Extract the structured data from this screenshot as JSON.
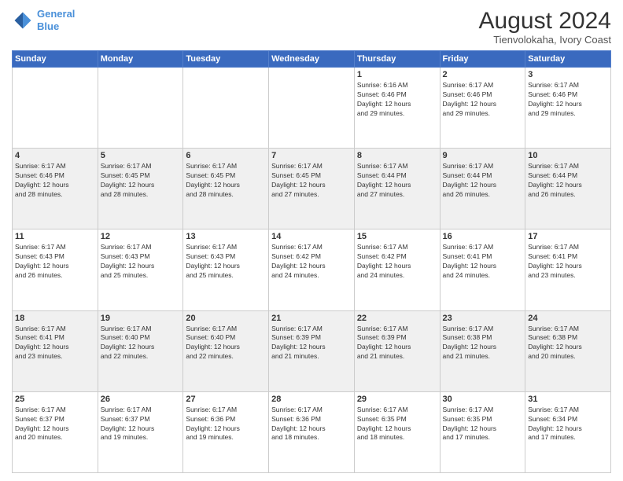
{
  "header": {
    "logo_line1": "General",
    "logo_line2": "Blue",
    "title": "August 2024",
    "subtitle": "Tienvolokaha, Ivory Coast"
  },
  "days_of_week": [
    "Sunday",
    "Monday",
    "Tuesday",
    "Wednesday",
    "Thursday",
    "Friday",
    "Saturday"
  ],
  "weeks": [
    [
      {
        "day": "",
        "info": ""
      },
      {
        "day": "",
        "info": ""
      },
      {
        "day": "",
        "info": ""
      },
      {
        "day": "",
        "info": ""
      },
      {
        "day": "1",
        "info": "Sunrise: 6:16 AM\nSunset: 6:46 PM\nDaylight: 12 hours\nand 29 minutes."
      },
      {
        "day": "2",
        "info": "Sunrise: 6:17 AM\nSunset: 6:46 PM\nDaylight: 12 hours\nand 29 minutes."
      },
      {
        "day": "3",
        "info": "Sunrise: 6:17 AM\nSunset: 6:46 PM\nDaylight: 12 hours\nand 29 minutes."
      }
    ],
    [
      {
        "day": "4",
        "info": "Sunrise: 6:17 AM\nSunset: 6:46 PM\nDaylight: 12 hours\nand 28 minutes."
      },
      {
        "day": "5",
        "info": "Sunrise: 6:17 AM\nSunset: 6:45 PM\nDaylight: 12 hours\nand 28 minutes."
      },
      {
        "day": "6",
        "info": "Sunrise: 6:17 AM\nSunset: 6:45 PM\nDaylight: 12 hours\nand 28 minutes."
      },
      {
        "day": "7",
        "info": "Sunrise: 6:17 AM\nSunset: 6:45 PM\nDaylight: 12 hours\nand 27 minutes."
      },
      {
        "day": "8",
        "info": "Sunrise: 6:17 AM\nSunset: 6:44 PM\nDaylight: 12 hours\nand 27 minutes."
      },
      {
        "day": "9",
        "info": "Sunrise: 6:17 AM\nSunset: 6:44 PM\nDaylight: 12 hours\nand 26 minutes."
      },
      {
        "day": "10",
        "info": "Sunrise: 6:17 AM\nSunset: 6:44 PM\nDaylight: 12 hours\nand 26 minutes."
      }
    ],
    [
      {
        "day": "11",
        "info": "Sunrise: 6:17 AM\nSunset: 6:43 PM\nDaylight: 12 hours\nand 26 minutes."
      },
      {
        "day": "12",
        "info": "Sunrise: 6:17 AM\nSunset: 6:43 PM\nDaylight: 12 hours\nand 25 minutes."
      },
      {
        "day": "13",
        "info": "Sunrise: 6:17 AM\nSunset: 6:43 PM\nDaylight: 12 hours\nand 25 minutes."
      },
      {
        "day": "14",
        "info": "Sunrise: 6:17 AM\nSunset: 6:42 PM\nDaylight: 12 hours\nand 24 minutes."
      },
      {
        "day": "15",
        "info": "Sunrise: 6:17 AM\nSunset: 6:42 PM\nDaylight: 12 hours\nand 24 minutes."
      },
      {
        "day": "16",
        "info": "Sunrise: 6:17 AM\nSunset: 6:41 PM\nDaylight: 12 hours\nand 24 minutes."
      },
      {
        "day": "17",
        "info": "Sunrise: 6:17 AM\nSunset: 6:41 PM\nDaylight: 12 hours\nand 23 minutes."
      }
    ],
    [
      {
        "day": "18",
        "info": "Sunrise: 6:17 AM\nSunset: 6:41 PM\nDaylight: 12 hours\nand 23 minutes."
      },
      {
        "day": "19",
        "info": "Sunrise: 6:17 AM\nSunset: 6:40 PM\nDaylight: 12 hours\nand 22 minutes."
      },
      {
        "day": "20",
        "info": "Sunrise: 6:17 AM\nSunset: 6:40 PM\nDaylight: 12 hours\nand 22 minutes."
      },
      {
        "day": "21",
        "info": "Sunrise: 6:17 AM\nSunset: 6:39 PM\nDaylight: 12 hours\nand 21 minutes."
      },
      {
        "day": "22",
        "info": "Sunrise: 6:17 AM\nSunset: 6:39 PM\nDaylight: 12 hours\nand 21 minutes."
      },
      {
        "day": "23",
        "info": "Sunrise: 6:17 AM\nSunset: 6:38 PM\nDaylight: 12 hours\nand 21 minutes."
      },
      {
        "day": "24",
        "info": "Sunrise: 6:17 AM\nSunset: 6:38 PM\nDaylight: 12 hours\nand 20 minutes."
      }
    ],
    [
      {
        "day": "25",
        "info": "Sunrise: 6:17 AM\nSunset: 6:37 PM\nDaylight: 12 hours\nand 20 minutes."
      },
      {
        "day": "26",
        "info": "Sunrise: 6:17 AM\nSunset: 6:37 PM\nDaylight: 12 hours\nand 19 minutes."
      },
      {
        "day": "27",
        "info": "Sunrise: 6:17 AM\nSunset: 6:36 PM\nDaylight: 12 hours\nand 19 minutes."
      },
      {
        "day": "28",
        "info": "Sunrise: 6:17 AM\nSunset: 6:36 PM\nDaylight: 12 hours\nand 18 minutes."
      },
      {
        "day": "29",
        "info": "Sunrise: 6:17 AM\nSunset: 6:35 PM\nDaylight: 12 hours\nand 18 minutes."
      },
      {
        "day": "30",
        "info": "Sunrise: 6:17 AM\nSunset: 6:35 PM\nDaylight: 12 hours\nand 17 minutes."
      },
      {
        "day": "31",
        "info": "Sunrise: 6:17 AM\nSunset: 6:34 PM\nDaylight: 12 hours\nand 17 minutes."
      }
    ]
  ]
}
